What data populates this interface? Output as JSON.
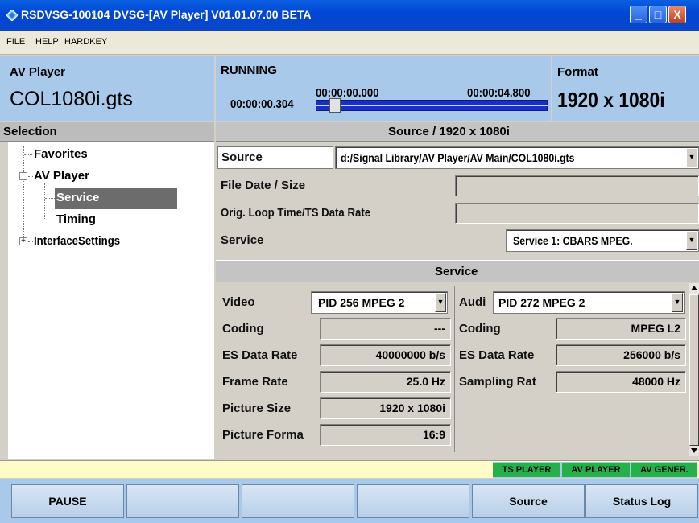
{
  "window": {
    "title": "RSDVSG-100104  DVSG-[AV Player]  V01.01.07.00 BETA",
    "minimize_glyph": "_",
    "maximize_glyph": "□",
    "close_glyph": "X"
  },
  "menu": [
    "FILE",
    "HELP",
    "HARDKEY"
  ],
  "header": {
    "module_label": "AV Player",
    "file_name": "COL1080i.gts",
    "state": "RUNNING",
    "current_time": "00:00:00.304",
    "start_time": "00:00:00.000",
    "end_time": "00:00:04.800",
    "format_label": "Format",
    "format_value": "1920 x 1080i"
  },
  "selection": {
    "title": "Selection",
    "tree": {
      "favorites": "Favorites",
      "av_player": "AV Player",
      "service": "Service",
      "timing": "Timing",
      "interface_settings": "InterfaceSettings"
    },
    "expanded_glyph": "−",
    "collapsed_glyph": "+"
  },
  "source_panel": {
    "title": "Source / 1920 x 1080i",
    "source_label": "Source",
    "source_value": "d:/Signal Library/AV Player/AV Main/COL1080i.gts",
    "file_date_label": "File Date / Size",
    "file_date_value": "",
    "loop_time_label": "Orig. Loop Time/TS Data Rate",
    "loop_time_value": "",
    "service_label": "Service",
    "service_value": "Service 1: CBARS MPEG."
  },
  "service_panel": {
    "title": "Service",
    "video": {
      "label": "Video",
      "pid": "PID 256  MPEG 2",
      "coding_label": "Coding",
      "coding_value": "---",
      "es_rate_label": "ES Data Rate",
      "es_rate_value": "40000000 b/s",
      "frame_rate_label": "Frame Rate",
      "frame_rate_value": "25.0 Hz",
      "picture_size_label": "Picture Size",
      "picture_size_value": "1920 x 1080i",
      "picture_format_label": "Picture Forma",
      "picture_format_value": "16:9"
    },
    "audio": {
      "label": "Audi",
      "pid": "PID 272  MPEG 2",
      "coding_label": "Coding",
      "coding_value": "MPEG L2",
      "es_rate_label": "ES Data Rate",
      "es_rate_value": "256000 b/s",
      "sampling_label": "Sampling Rat",
      "sampling_value": "48000 Hz"
    }
  },
  "status_tags": [
    "TS PLAYER",
    "AV PLAYER",
    "AV GENER."
  ],
  "softkeys": [
    "PAUSE",
    "",
    "",
    "",
    "Source",
    "Status Log"
  ],
  "playback": {
    "position_fraction": 0.063
  },
  "colors": {
    "title_bar": "#0046d5",
    "header_blue": "#a9c9ea",
    "selection_highlight": "#6c6c6c",
    "tag_green": "#26b04a",
    "status_yellow": "#fffcc8",
    "seek_blue": "#1630c8"
  }
}
